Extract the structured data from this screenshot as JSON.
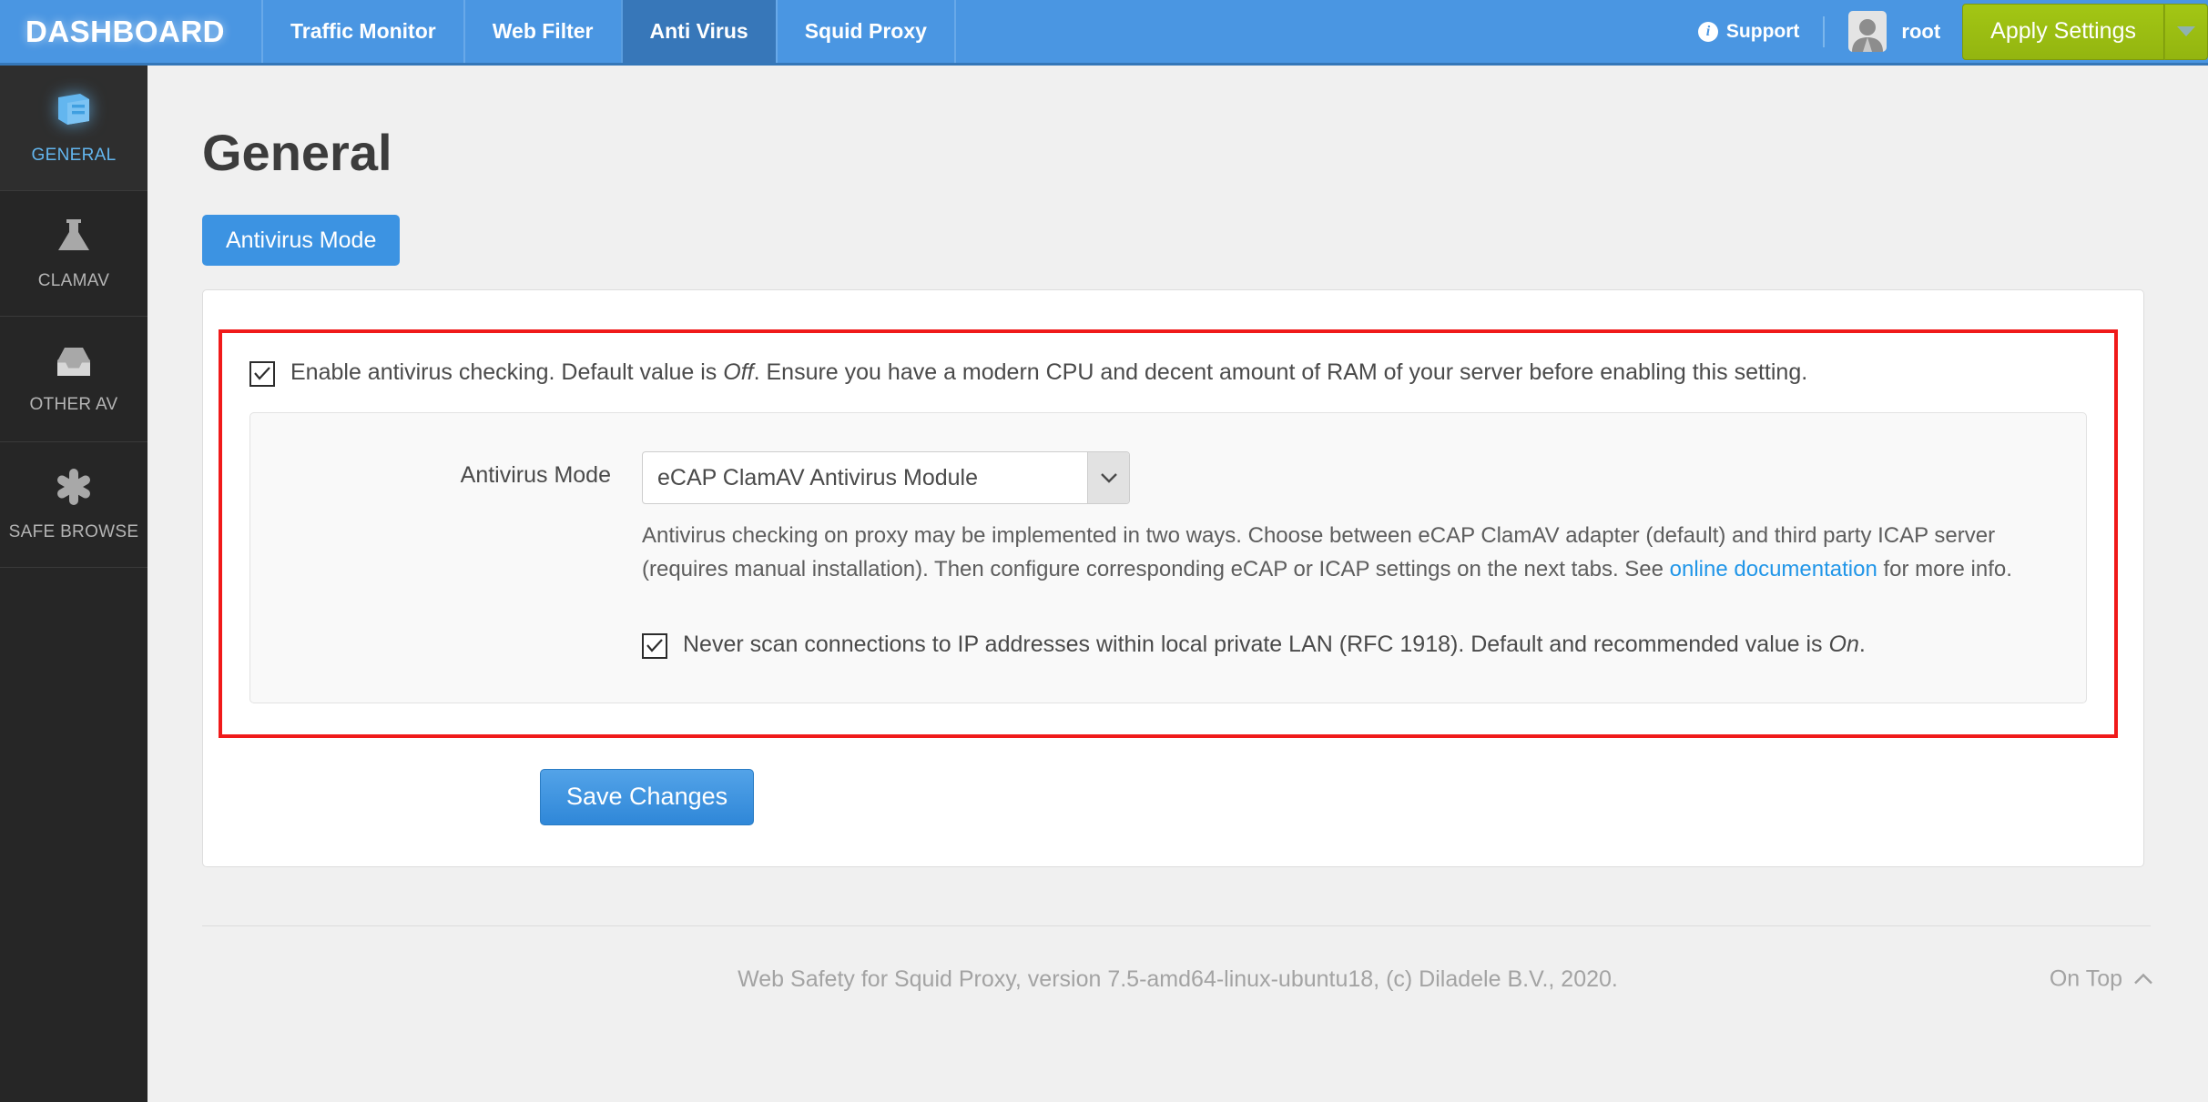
{
  "navbar": {
    "brand": "DASHBOARD",
    "tabs": [
      {
        "label": "Traffic Monitor",
        "active": false
      },
      {
        "label": "Web Filter",
        "active": false
      },
      {
        "label": "Anti Virus",
        "active": true
      },
      {
        "label": "Squid Proxy",
        "active": false
      }
    ],
    "support_label": "Support",
    "support_icon": "info-circle-icon",
    "avatar_icon": "user-avatar-icon",
    "username": "root",
    "apply_label": "Apply Settings",
    "apply_caret_icon": "caret-down-icon",
    "colors": {
      "nav_bg": "#4a96e2",
      "nav_active": "#3777b9",
      "apply_green": "#a3c614"
    }
  },
  "sidebar": {
    "items": [
      {
        "label": "GENERAL",
        "icon": "book-icon",
        "active": true
      },
      {
        "label": "CLAMAV",
        "icon": "flask-icon",
        "active": false
      },
      {
        "label": "OTHER AV",
        "icon": "inbox-icon",
        "active": false
      },
      {
        "label": "SAFE BROWSE",
        "icon": "asterisk-icon",
        "active": false
      }
    ],
    "active_color": "#63b6ef"
  },
  "main": {
    "page_title": "General",
    "tab_label": "Antivirus Mode",
    "highlight_color": "#f01a1a",
    "enable_checkbox": {
      "checked": true,
      "text_before": "Enable antivirus checking. Default value is ",
      "emphasis": "Off",
      "text_after": ". Ensure you have a modern CPU and decent amount of RAM of your server before enabling this setting."
    },
    "mode_field": {
      "label": "Antivirus Mode",
      "selected": "eCAP ClamAV Antivirus Module",
      "chevron_icon": "chevron-down-icon",
      "help_before": "Antivirus checking on proxy may be implemented in two ways. Choose between eCAP ClamAV adapter (default) and third party ICAP server (requires manual installation). Then configure corresponding eCAP or ICAP settings on the next tabs. See ",
      "help_link": "online documentation",
      "help_after": " for more info."
    },
    "lan_checkbox": {
      "checked": true,
      "text_before": "Never scan connections to IP addresses within local private LAN (RFC 1918). Default and recommended value is ",
      "emphasis": "On",
      "text_after": "."
    },
    "save_label": "Save Changes"
  },
  "footer": {
    "text": "Web Safety for Squid Proxy, version 7.5-amd64-linux-ubuntu18, (c) Diladele B.V., 2020.",
    "ontop_label": "On Top",
    "ontop_icon": "chevron-up-icon"
  }
}
